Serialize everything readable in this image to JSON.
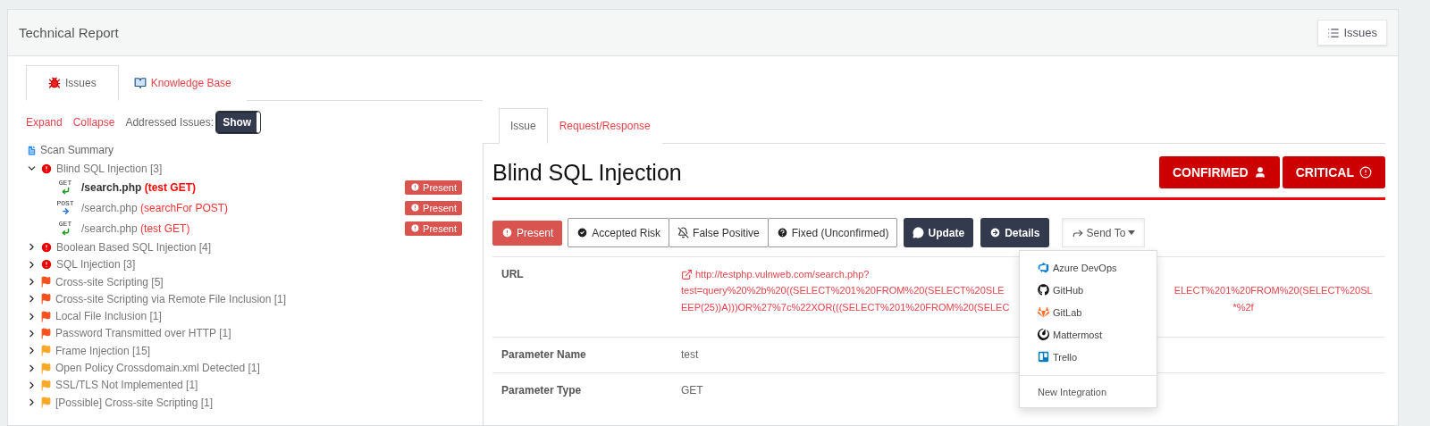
{
  "header": {
    "title": "Technical Report",
    "issues_button": "Issues"
  },
  "main_tabs": [
    {
      "label": "Issues",
      "selected": true,
      "kind": "bug"
    },
    {
      "label": "Knowledge Base",
      "selected": false,
      "kind": "book"
    }
  ],
  "toolbar": {
    "expand": "Expand",
    "collapse": "Collapse",
    "addressed_label": "Addressed Issues:",
    "addressed_toggle": "Show"
  },
  "tree": {
    "summary": "Scan Summary",
    "items": [
      {
        "label": "Blind SQL Injection [3]",
        "kind": "critical",
        "expanded": true,
        "children": [
          {
            "path": "/search.php",
            "param": "(test GET)",
            "method": "GET",
            "selected": true,
            "status": "Present"
          },
          {
            "path": "/search.php",
            "param": "(searchFor POST)",
            "method": "POST",
            "selected": false,
            "status": "Present"
          },
          {
            "path": "/search.php",
            "param": "(test GET)",
            "method": "GET",
            "selected": false,
            "status": "Present"
          }
        ]
      },
      {
        "label": "Boolean Based SQL Injection [4]",
        "kind": "critical",
        "expanded": false
      },
      {
        "label": "SQL Injection [3]",
        "kind": "critical",
        "expanded": false
      },
      {
        "label": "Cross-site Scripting [5]",
        "kind": "high",
        "expanded": false
      },
      {
        "label": "Cross-site Scripting via Remote File Inclusion [1]",
        "kind": "high",
        "expanded": false
      },
      {
        "label": "Local File Inclusion [1]",
        "kind": "high",
        "expanded": false
      },
      {
        "label": "Password Transmitted over HTTP [1]",
        "kind": "high",
        "expanded": false
      },
      {
        "label": "Frame Injection [15]",
        "kind": "medium",
        "expanded": false
      },
      {
        "label": "Open Policy Crossdomain.xml Detected [1]",
        "kind": "medium",
        "expanded": false
      },
      {
        "label": "SSL/TLS Not Implemented [1]",
        "kind": "medium",
        "expanded": false
      },
      {
        "label": "[Possible] Cross-site Scripting [1]",
        "kind": "medium",
        "expanded": false
      }
    ]
  },
  "issue_tabs": [
    {
      "label": "Issue",
      "selected": true
    },
    {
      "label": "Request/Response",
      "selected": false
    }
  ],
  "issue": {
    "title": "Blind SQL Injection",
    "badges": [
      {
        "label": "CONFIRMED",
        "kind": "confirmed"
      },
      {
        "label": "CRITICAL",
        "kind": "severity"
      }
    ],
    "states": [
      {
        "label": "Present",
        "kind": "exclamation",
        "selected": true
      },
      {
        "label": "Accepted Risk",
        "kind": "check",
        "selected": false
      },
      {
        "label": "False Positive",
        "kind": "muted",
        "selected": false
      },
      {
        "label": "Fixed (Unconfirmed)",
        "kind": "question",
        "selected": false
      }
    ],
    "actions": [
      {
        "label": "Update",
        "kind": "comment"
      },
      {
        "label": "Details",
        "kind": "arrow"
      }
    ],
    "send_to": {
      "label": "Send To",
      "expanded": true,
      "menu": [
        {
          "label": "Azure DevOps",
          "kind": "azure"
        },
        {
          "label": "GitHub",
          "kind": "github"
        },
        {
          "label": "GitLab",
          "kind": "gitlab"
        },
        {
          "label": "Mattermost",
          "kind": "mattermost"
        },
        {
          "label": "Trello",
          "kind": "trello"
        }
      ],
      "footer": "New Integration"
    },
    "details": [
      {
        "label": "URL",
        "kind": "url",
        "lines": [
          [
            "http://testphp.vulnweb.com/search.php?"
          ],
          [
            "test=query%20%2b%20((SELECT%201%20FROM%20(SELECT%20SLE",
            "ELECT%201%20FROM%20(SELECT%20SL"
          ],
          [
            "EEP(25))A)))OR%27%7c%22XOR(((SELECT%201%20FROM%20(SELEC",
            "*%2f"
          ]
        ]
      },
      {
        "label": "Parameter Name",
        "kind": "text",
        "value": "test"
      },
      {
        "label": "Parameter Type",
        "kind": "text",
        "value": "GET"
      }
    ]
  }
}
